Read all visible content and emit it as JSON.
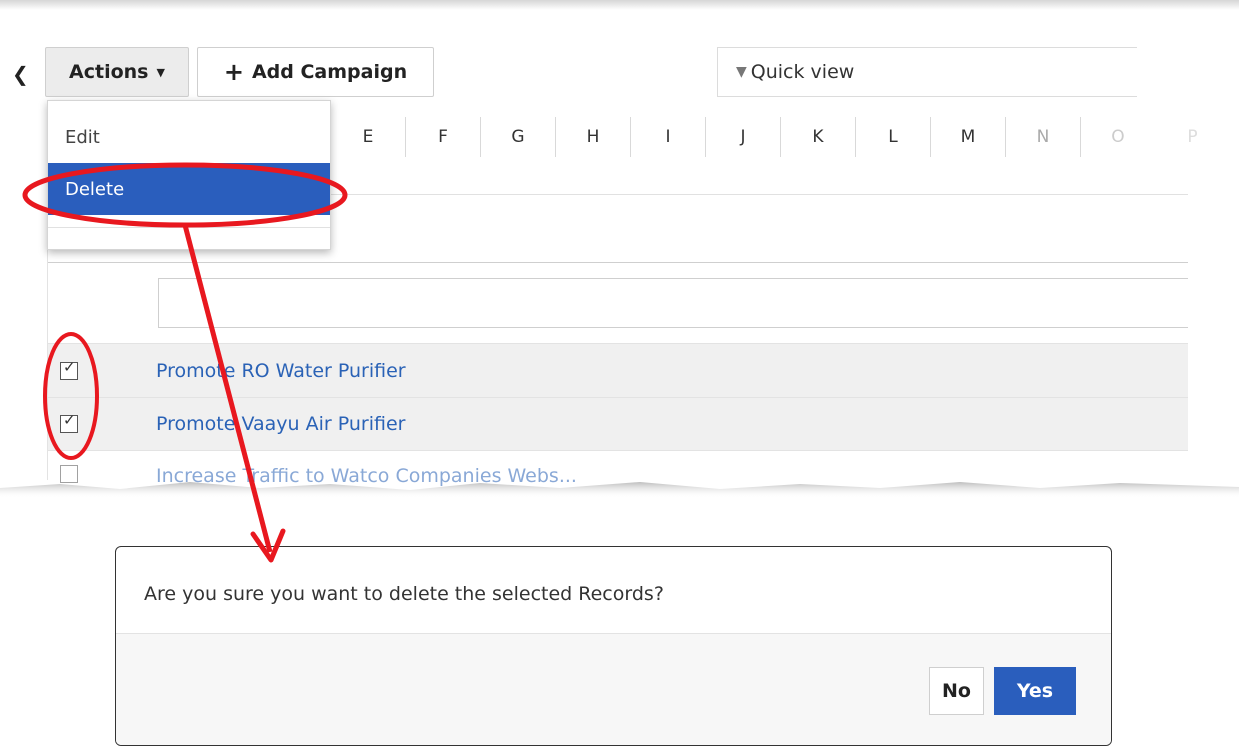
{
  "toolbar": {
    "back_icon": "chevron-left-icon",
    "actions_label": "Actions",
    "add_campaign_label": "Add Campaign",
    "quick_view_label": "Quick view"
  },
  "actions_menu": {
    "items": [
      {
        "label": "Edit"
      },
      {
        "label": "Delete",
        "highlighted": true
      }
    ]
  },
  "alphabet_filter": [
    "E",
    "F",
    "G",
    "H",
    "I",
    "J",
    "K",
    "L",
    "M",
    "N",
    "O",
    "P"
  ],
  "campaigns": [
    {
      "name": "Promote RO Water Purifier",
      "checked": true
    },
    {
      "name": "Promote Vaayu Air Purifier",
      "checked": true
    },
    {
      "name": "Increase Traffic to Watco Companies Webs...",
      "checked": false
    }
  ],
  "confirm_dialog": {
    "message": "Are you sure you want to delete the selected Records?",
    "no_label": "No",
    "yes_label": "Yes"
  },
  "colors": {
    "accent": "#2a5ebd",
    "link": "#2a62b6",
    "annotation": "#e8181f",
    "row_selected_bg": "#f0f0f0"
  }
}
